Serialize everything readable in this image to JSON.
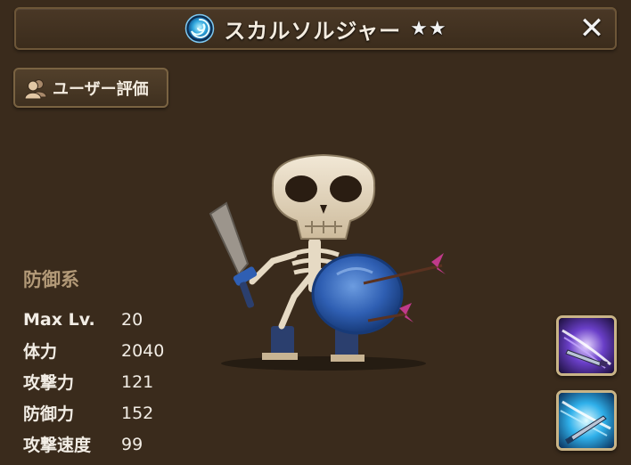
{
  "header": {
    "title": "スカルソルジャー",
    "stars": [
      "★",
      "★"
    ],
    "element_icon": "water-element-icon",
    "close_label": "✕"
  },
  "user_review": {
    "label": "ユーザー評価",
    "icon": "people-icon"
  },
  "monster": {
    "type": "防御系",
    "stats": [
      {
        "label": "Max Lv.",
        "value": "20"
      },
      {
        "label": "体力",
        "value": "2040"
      },
      {
        "label": "攻撃力",
        "value": "121"
      },
      {
        "label": "防御力",
        "value": "152"
      },
      {
        "label": "攻撃速度",
        "value": "99"
      }
    ],
    "portrait": "skeleton-soldier-figure"
  },
  "skills": [
    {
      "icon": "purple-sword-slash-icon"
    },
    {
      "icon": "blue-sword-slash-icon"
    }
  ],
  "colors": {
    "background": "#3a2b1c",
    "frame": "#6d5638",
    "type_label": "#b39a78",
    "text": "#f2ede5"
  }
}
